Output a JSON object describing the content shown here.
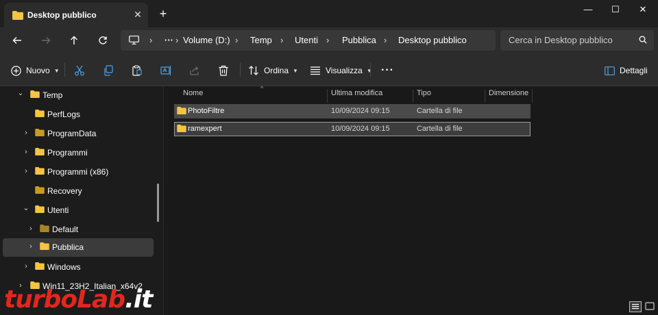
{
  "window": {
    "tab_title": "Desktop pubblico",
    "tab_close": "✕",
    "new_tab": "+",
    "minimize": "—",
    "maximize": "☐",
    "close": "✕"
  },
  "address": {
    "overflow": "···",
    "breadcrumbs": [
      "Volume (D:)",
      "Temp",
      "Utenti",
      "Pubblica",
      "Desktop pubblico"
    ],
    "separator": "›"
  },
  "search": {
    "placeholder": "Cerca in Desktop pubblico"
  },
  "commands": {
    "new_label": "Nuovo",
    "sort_label": "Ordina",
    "view_label": "Visualizza",
    "more": "···",
    "details_label": "Dettagli"
  },
  "tree": [
    {
      "label": "Temp",
      "expanded": true,
      "chevron": "⌄"
    },
    {
      "label": "PerfLogs",
      "chevron": ""
    },
    {
      "label": "ProgramData",
      "chevron": "›"
    },
    {
      "label": "Programmi",
      "chevron": "›"
    },
    {
      "label": "Programmi (x86)",
      "chevron": "›"
    },
    {
      "label": "Recovery",
      "chevron": ""
    },
    {
      "label": "Utenti",
      "expanded": true,
      "chevron": "⌄"
    },
    {
      "label": "Default",
      "chevron": "›"
    },
    {
      "label": "Pubblica",
      "chevron": "›",
      "selected": true
    },
    {
      "label": "Windows",
      "chevron": "›"
    },
    {
      "label": "Win11_23H2_Italian_x64v2",
      "chevron": "›"
    }
  ],
  "columns": {
    "name": "Nome",
    "modified": "Ultima modifica",
    "type": "Tipo",
    "size": "Dimensione"
  },
  "files": [
    {
      "name": "PhotoFiltre",
      "modified": "10/09/2024 09:15",
      "type": "Cartella di file",
      "size": ""
    },
    {
      "name": "ramexpert",
      "modified": "10/09/2024 09:15",
      "type": "Cartella di file",
      "size": ""
    }
  ],
  "watermark": {
    "turbo": "turbo",
    "lab": "Lab",
    "it": ".it"
  },
  "colors": {
    "folder": "#f4c542",
    "folder_dark": "#c99a1c",
    "watermark_red": "#e2271e",
    "accent_blue": "#4ea3e8"
  }
}
